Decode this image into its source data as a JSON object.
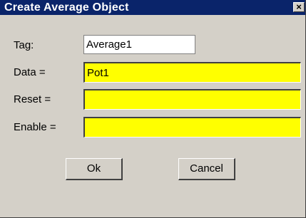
{
  "window": {
    "title": "Create Average Object",
    "close_glyph": "×"
  },
  "form": {
    "tag_label": "Tag:",
    "tag_value": "Average1",
    "data_label": "Data =",
    "data_value": "Pot1",
    "reset_label": "Reset =",
    "reset_value": "",
    "enable_label": "Enable =",
    "enable_value": ""
  },
  "buttons": {
    "ok_label": "Ok",
    "cancel_label": "Cancel"
  },
  "colors": {
    "titlebar": "#0a246a",
    "dialog_bg": "#d4d0c8",
    "highlight_field": "#ffff00"
  }
}
